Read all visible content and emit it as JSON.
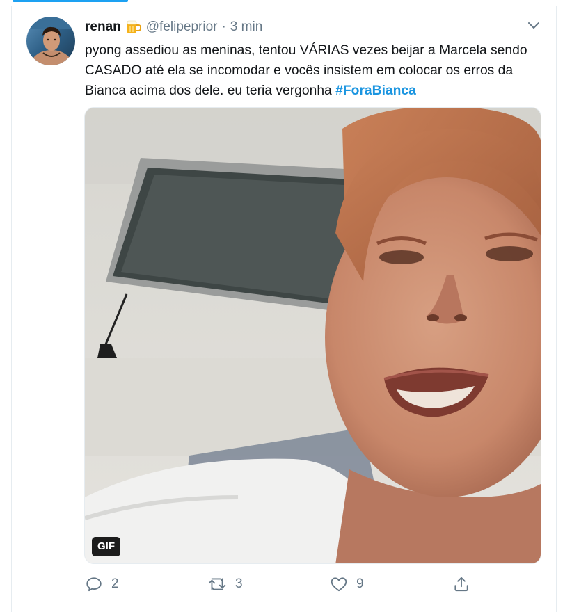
{
  "tweet": {
    "name": "renan",
    "emoji": "beer-mug-emoji",
    "handle": "@felipeprior",
    "separator": "·",
    "time": "3 min",
    "text_before": "pyong assediou as meninas, tentou VÁRIAS vezes beijar a Marcela sendo CASADO até ela se incomodar e vocês insistem em colocar os erros da Bianca acima dos dele. eu teria vergonha ",
    "hashtag": "#ForaBianca",
    "media": {
      "badge": "GIF"
    },
    "actions": {
      "replies": "2",
      "retweets": "3",
      "likes": "9"
    }
  },
  "colors": {
    "accent": "#1da1f2",
    "hashtag": "#1b95e0",
    "muted": "#657786",
    "border": "#e6ecf0"
  },
  "icons": [
    "chevron-down-icon",
    "reply-icon",
    "retweet-icon",
    "like-icon",
    "share-icon"
  ]
}
